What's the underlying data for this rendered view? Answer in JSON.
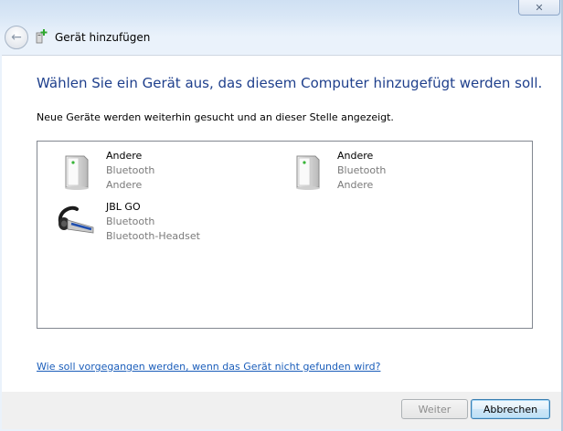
{
  "window": {
    "title": "Gerät hinzufügen",
    "close_label": "✕",
    "breadcrumb_hint": ""
  },
  "main": {
    "heading": "Wählen Sie ein Gerät aus, das diesem Computer hinzugefügt werden soll.",
    "subtext": "Neue Geräte werden weiterhin gesucht und an dieser Stelle angezeigt.",
    "devices": [
      {
        "name": "Andere",
        "line1": "Bluetooth",
        "line2": "Andere",
        "icon": "computer-tower-icon"
      },
      {
        "name": "Andere",
        "line1": "Bluetooth",
        "line2": "Andere",
        "icon": "computer-tower-icon"
      },
      {
        "name": "JBL GO",
        "line1": "Bluetooth",
        "line2": "Bluetooth-Headset",
        "icon": "bluetooth-headset-icon"
      }
    ],
    "help_link": "Wie soll vorgegangen werden, wenn das Gerät nicht gefunden wird?"
  },
  "footer": {
    "next_label": "Weiter",
    "cancel_label": "Abbrechen"
  },
  "colors": {
    "heading": "#1e3f8c",
    "link": "#1a5dba",
    "muted_text": "#7a7a7a"
  }
}
